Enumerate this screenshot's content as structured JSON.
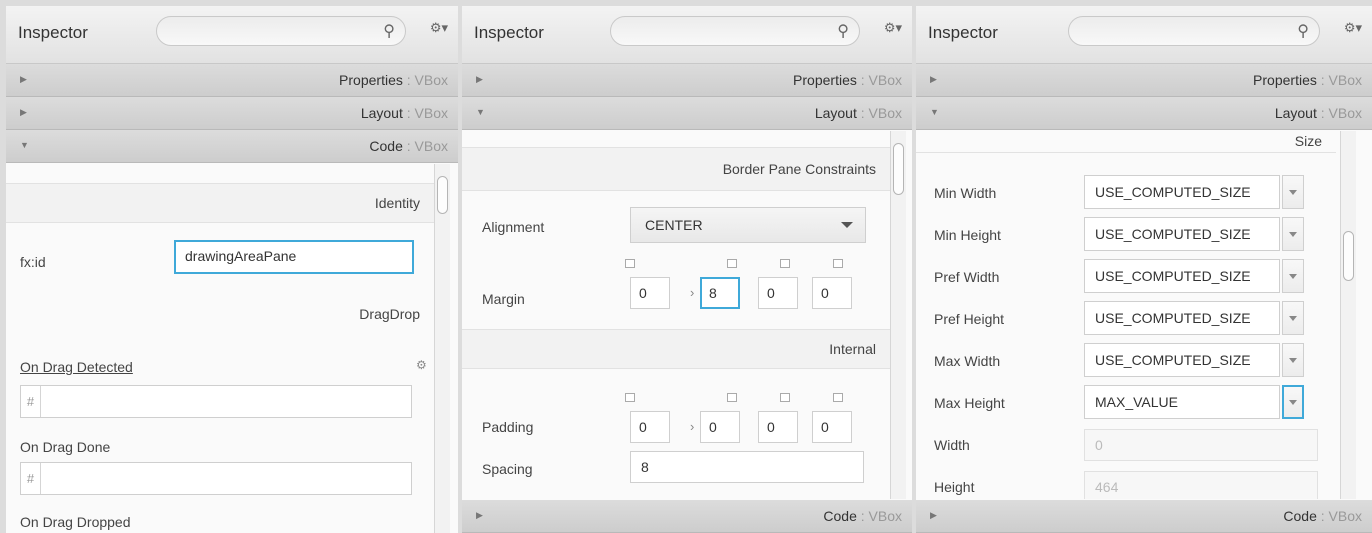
{
  "inspector_title": "Inspector",
  "sections": {
    "properties": {
      "name": "Properties",
      "type": "VBox"
    },
    "layout": {
      "name": "Layout",
      "type": "VBox"
    },
    "code": {
      "name": "Code",
      "type": "VBox"
    }
  },
  "separator": " : ",
  "panel1": {
    "identity_header": "Identity",
    "fxid_label": "fx:id",
    "fxid_value": "drawingAreaPane",
    "dragdrop_header": "DragDrop",
    "on_drag_detected": "On Drag Detected",
    "on_drag_done": "On Drag Done",
    "on_drag_dropped": "On Drag Dropped",
    "hash": "#"
  },
  "panel2": {
    "constraints_header": "Border Pane Constraints",
    "alignment_label": "Alignment",
    "alignment_value": "CENTER",
    "margin_label": "Margin",
    "margin": [
      "0",
      "8",
      "0",
      "0"
    ],
    "internal_header": "Internal",
    "padding_label": "Padding",
    "padding": [
      "0",
      "0",
      "0",
      "0"
    ],
    "spacing_label": "Spacing",
    "spacing_value": "8"
  },
  "panel3": {
    "size_header": "Size",
    "rows": [
      {
        "label": "Min Width",
        "value": "USE_COMPUTED_SIZE"
      },
      {
        "label": "Min Height",
        "value": "USE_COMPUTED_SIZE"
      },
      {
        "label": "Pref Width",
        "value": "USE_COMPUTED_SIZE"
      },
      {
        "label": "Pref Height",
        "value": "USE_COMPUTED_SIZE"
      },
      {
        "label": "Max Width",
        "value": "USE_COMPUTED_SIZE"
      },
      {
        "label": "Max Height",
        "value": "MAX_VALUE"
      }
    ],
    "width_label": "Width",
    "width_value": "0",
    "height_label": "Height",
    "height_value": "464"
  },
  "colors": {
    "focus": "#3fa9d9",
    "section_bg": "#d4d4d4"
  }
}
